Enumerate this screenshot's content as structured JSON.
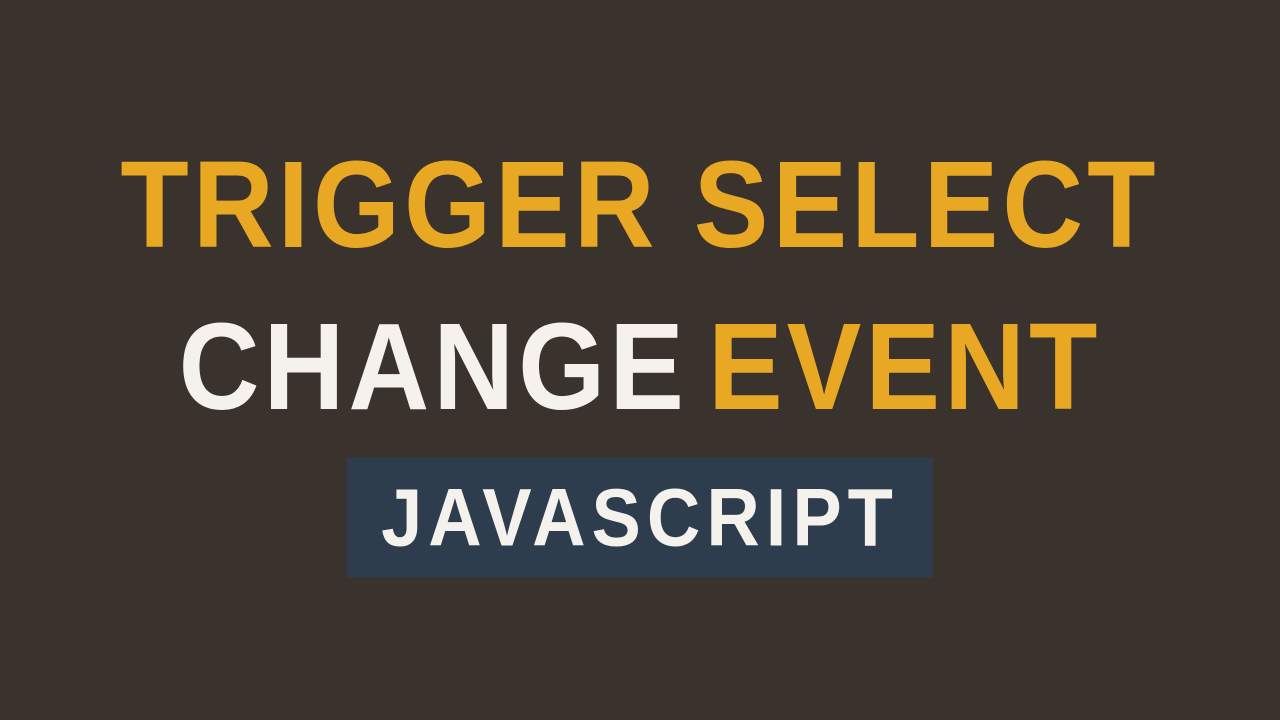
{
  "title": {
    "line1": "TRIGGER SELECT",
    "line2_word1": "CHANGE",
    "line2_word2": "EVENT"
  },
  "badge_label": "JAVASCRIPT",
  "colors": {
    "background": "#3a322d",
    "accent_yellow": "#e9a824",
    "text_white": "#f5f2ee",
    "badge_bg": "#2e3d4d"
  }
}
